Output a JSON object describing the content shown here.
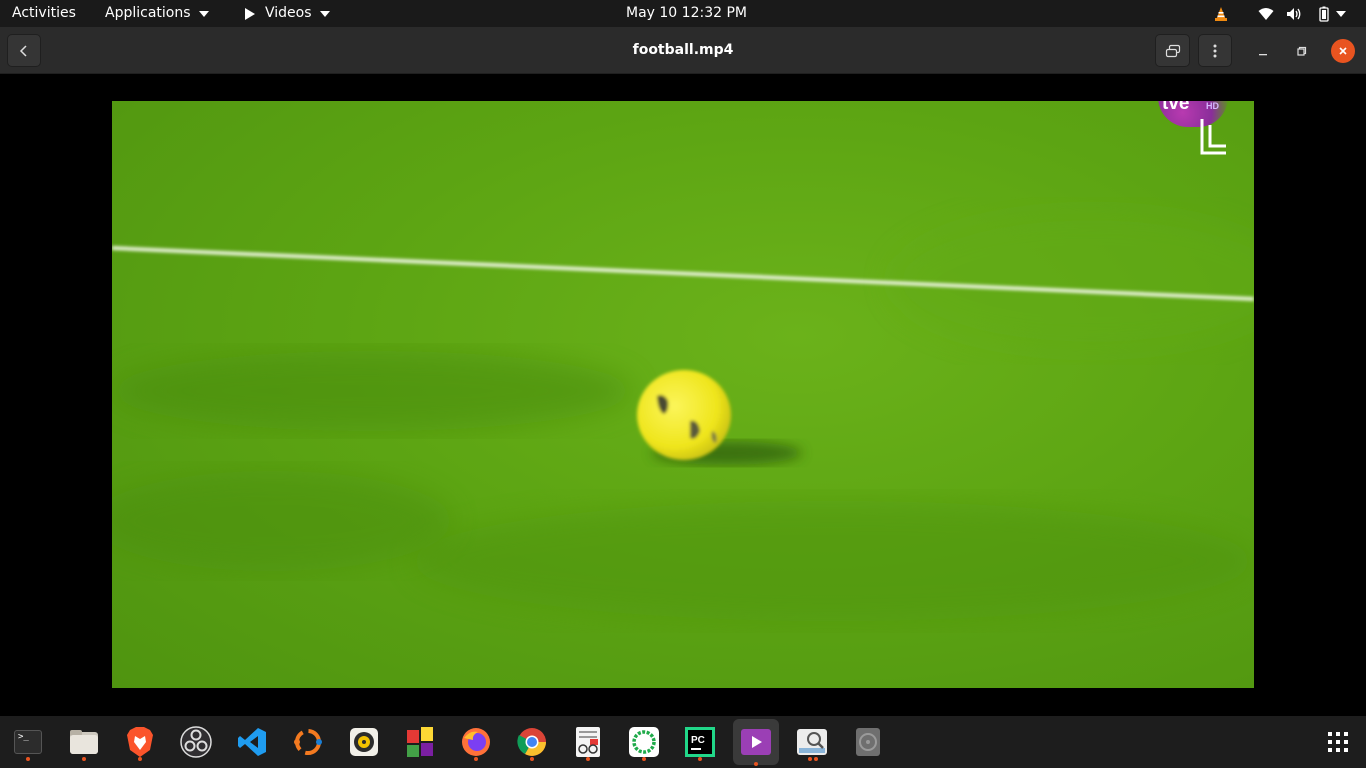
{
  "topbar": {
    "activities": "Activities",
    "applications": "Applications",
    "app_menu": "Videos",
    "clock": "May 10  12:32 PM"
  },
  "window": {
    "title": "football.mp4"
  },
  "video": {
    "overlay_logo": "tve",
    "overlay_hd": "HD"
  },
  "dock": {
    "items": [
      {
        "name": "terminal",
        "running": true
      },
      {
        "name": "files",
        "running": true
      },
      {
        "name": "brave",
        "running": true
      },
      {
        "name": "obs-studio",
        "running": false
      },
      {
        "name": "vscode",
        "running": false
      },
      {
        "name": "app-orange-circle",
        "running": false
      },
      {
        "name": "rhythmbox",
        "running": false
      },
      {
        "name": "colorful-app",
        "running": false
      },
      {
        "name": "firefox",
        "running": true
      },
      {
        "name": "chrome",
        "running": true
      },
      {
        "name": "document-viewer",
        "running": true
      },
      {
        "name": "green-ring-app",
        "running": true
      },
      {
        "name": "pycharm",
        "running": true
      },
      {
        "name": "videos",
        "running": true
      },
      {
        "name": "image-viewer",
        "running": true
      },
      {
        "name": "disk-app",
        "running": false
      }
    ],
    "show_apps": "show-applications-icon"
  },
  "colors": {
    "accent": "#e95420",
    "field_green": "#5da513",
    "ball_yellow": "#f2ea1e"
  }
}
